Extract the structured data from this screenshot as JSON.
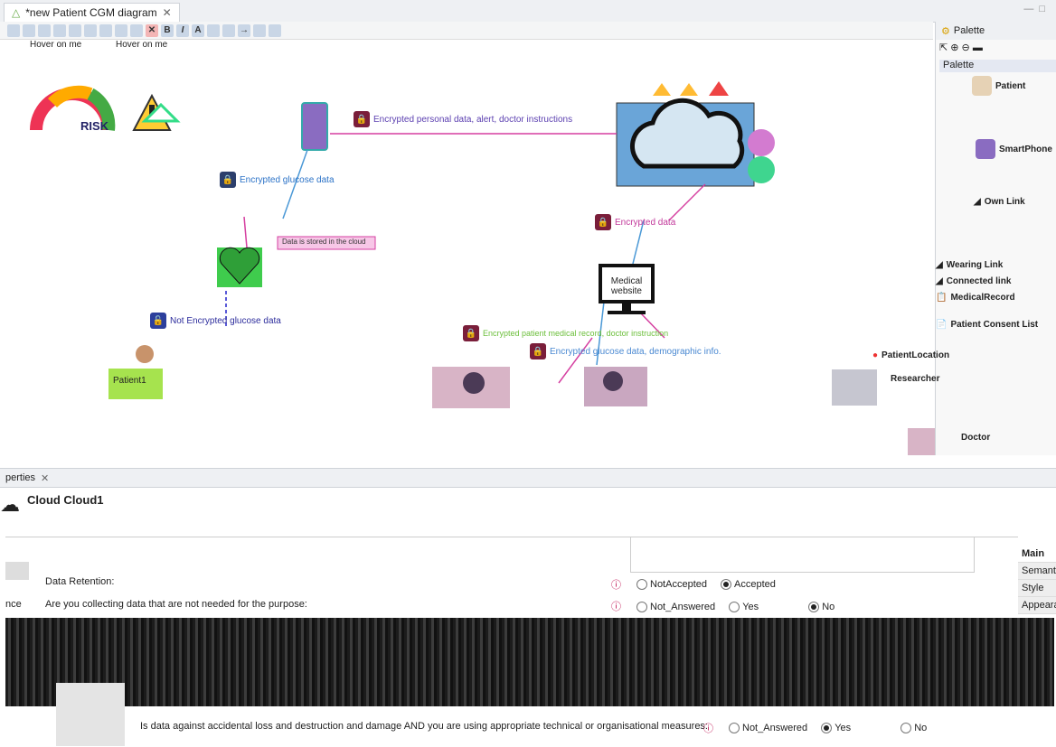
{
  "editor": {
    "tab_title": "*new Patient CGM diagram"
  },
  "canvas": {
    "hover_labels": [
      "Hover on me",
      "Hover on me"
    ],
    "risk_label": "RISK",
    "edge_labels": {
      "encrypted_personal": "Encrypted personal data, alert, doctor instructions",
      "encrypted_glucose": "Encrypted glucose data",
      "encrypted_data": "Encrypted data",
      "stored_note": "Data is stored in the cloud",
      "not_encrypted": "Not Encrypted glucose data",
      "encrypted_record": "Encrypted patient medical record, doctor instruction",
      "encrypted_demo": "Encrypted glucose data, demographic info."
    },
    "website_label": "Medical website",
    "patient_label": "Patient1"
  },
  "palette": {
    "title": "Palette",
    "section": "Palette",
    "items": [
      "Patient",
      "SmartPhone",
      "Own Link",
      "Wearing Link",
      "Connected link",
      "MedicalRecord",
      "Patient Consent List",
      "PatientLocation",
      "Researcher",
      "Doctor"
    ]
  },
  "properties": {
    "tab_label": "perties",
    "element_title": "Cloud Cloud1",
    "side_tabs": [
      "Main",
      "Semantic",
      "Style",
      "Appearance"
    ],
    "retention_label": "Data Retention:",
    "retention_options": [
      "NotAccepted",
      "Accepted"
    ],
    "q1": "Are you collecting data that are not needed for the purpose:",
    "q1_options": [
      "Not_Answered",
      "Yes",
      "No"
    ],
    "q_last": "Is data against accidental loss and destruction and damage AND you are using appropriate technical or organisational measures:",
    "q_last_options": [
      "Not_Answered",
      "Yes",
      "No"
    ],
    "left_label": "nce"
  }
}
